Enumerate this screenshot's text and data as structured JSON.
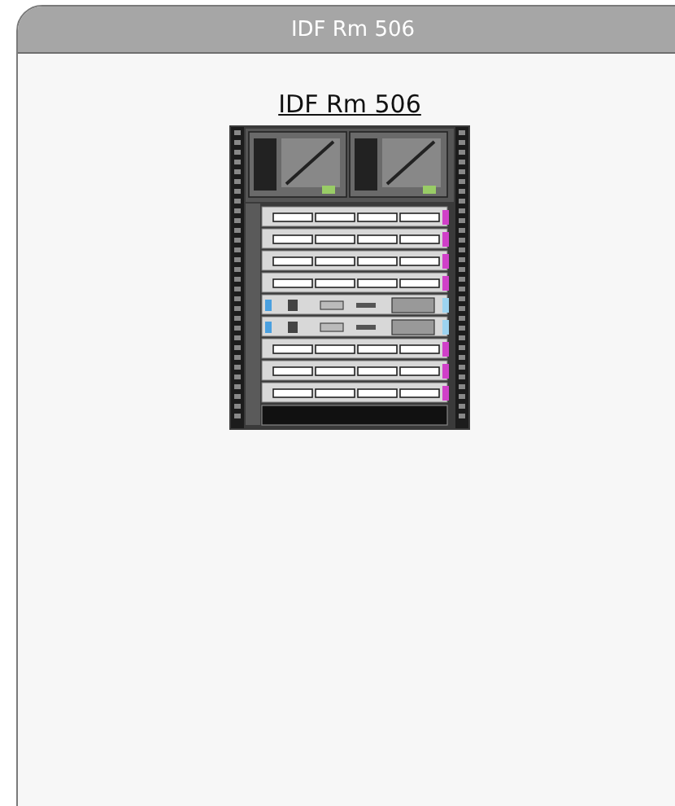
{
  "panel": {
    "header_title": "IDF Rm 506",
    "heading": "IDF Rm 506"
  }
}
